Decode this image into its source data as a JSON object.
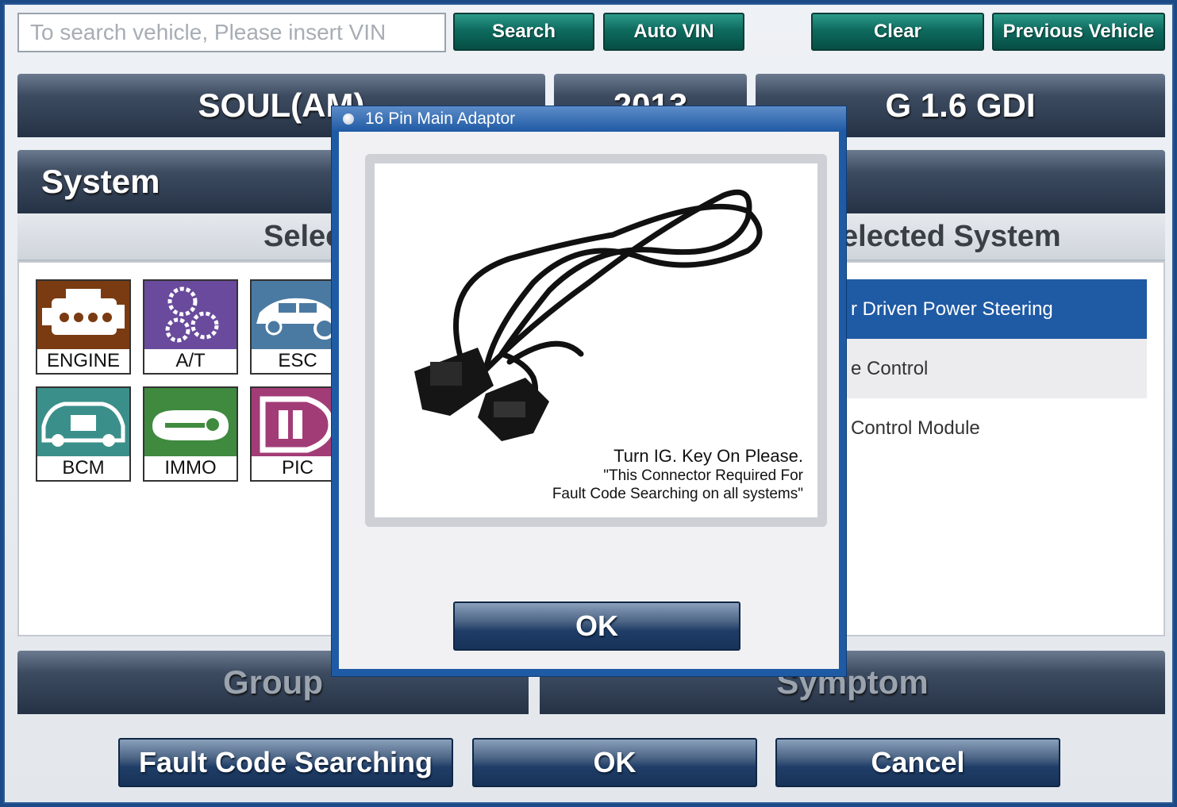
{
  "toolbar": {
    "vin_placeholder": "To search vehicle, Please insert VIN",
    "search_label": "Search",
    "auto_vin_label": "Auto VIN",
    "clear_label": "Clear",
    "previous_vehicle_label": "Previous Vehicle"
  },
  "vehicle": {
    "model": "SOUL(AM)",
    "year": "2013",
    "engine": "G 1.6 GDI"
  },
  "system_panel": {
    "title": "System",
    "select_header": "Selec",
    "selected_header": "elected System",
    "tiles": [
      {
        "label": "ENGINE",
        "icon": "engine-icon",
        "color": "#7a3b12"
      },
      {
        "label": "A/T",
        "icon": "gears-icon",
        "color": "#6a4a9c"
      },
      {
        "label": "ESC",
        "icon": "car-brake-icon",
        "color": "#4a7aa2"
      },
      {
        "label": "BCM",
        "icon": "car-battery-icon",
        "color": "#3b8f8a"
      },
      {
        "label": "IMMO",
        "icon": "key-icon",
        "color": "#3f8a3f"
      },
      {
        "label": "PIC",
        "icon": "smart-key-icon",
        "color": "#a23c77"
      }
    ],
    "selected_systems": [
      {
        "label": "r Driven Power Steering",
        "highlighted": true
      },
      {
        "label": "e Control",
        "highlighted": false
      },
      {
        "label": "Control Module",
        "highlighted": false
      }
    ]
  },
  "lower_bars": {
    "group_label": "Group",
    "symptom_label": "Symptom"
  },
  "bottom_buttons": {
    "fault_code_label": "Fault Code Searching",
    "ok_label": "OK",
    "cancel_label": "Cancel"
  },
  "modal": {
    "title": "16 Pin Main Adaptor",
    "instruction": "Turn IG. Key On Please.",
    "note_line1": "\"This Connector Required For",
    "note_line2": "Fault Code Searching on all systems\"",
    "ok_label": "OK"
  },
  "colors": {
    "accent_blue": "#1f5aa4",
    "toolbar_green": "#0e6b5e",
    "highlight_row": "#1f5aa4"
  }
}
